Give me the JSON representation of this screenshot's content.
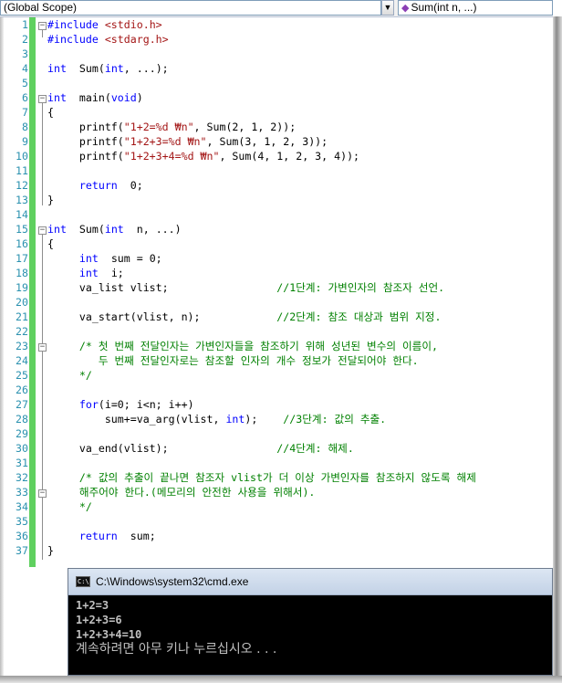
{
  "navbar": {
    "scope": "(Global Scope)",
    "member": "Sum(int n, ...)"
  },
  "editor": {
    "lines": [
      {
        "n": "1",
        "t": [
          [
            "pp",
            "#include "
          ],
          [
            "inc",
            "<stdio.h>"
          ]
        ]
      },
      {
        "n": "2",
        "t": [
          [
            "pp",
            "#include "
          ],
          [
            "inc",
            "<stdarg.h>"
          ]
        ]
      },
      {
        "n": "3",
        "t": []
      },
      {
        "n": "4",
        "t": [
          [
            "kw",
            "int"
          ],
          [
            "",
            "  Sum("
          ],
          [
            "kw",
            "int"
          ],
          [
            "",
            ", ...);"
          ]
        ]
      },
      {
        "n": "5",
        "t": []
      },
      {
        "n": "6",
        "t": [
          [
            "kw",
            "int"
          ],
          [
            "",
            "  main("
          ],
          [
            "kw",
            "void"
          ],
          [
            "",
            ")"
          ]
        ]
      },
      {
        "n": "7",
        "t": [
          [
            "",
            "{"
          ]
        ]
      },
      {
        "n": "8",
        "t": [
          [
            "",
            "     printf("
          ],
          [
            "str",
            "\"1+2=%d ₩n\""
          ],
          [
            "",
            ", Sum(2, 1, 2));"
          ]
        ]
      },
      {
        "n": "9",
        "t": [
          [
            "",
            "     printf("
          ],
          [
            "str",
            "\"1+2+3=%d ₩n\""
          ],
          [
            "",
            ", Sum(3, 1, 2, 3));"
          ]
        ]
      },
      {
        "n": "10",
        "t": [
          [
            "",
            "     printf("
          ],
          [
            "str",
            "\"1+2+3+4=%d ₩n\""
          ],
          [
            "",
            ", Sum(4, 1, 2, 3, 4));"
          ]
        ]
      },
      {
        "n": "11",
        "t": []
      },
      {
        "n": "12",
        "t": [
          [
            "",
            "     "
          ],
          [
            "kw",
            "return"
          ],
          [
            "",
            "  0;"
          ]
        ]
      },
      {
        "n": "13",
        "t": [
          [
            "",
            "}"
          ]
        ]
      },
      {
        "n": "14",
        "t": []
      },
      {
        "n": "15",
        "t": [
          [
            "kw",
            "int"
          ],
          [
            "",
            "  Sum("
          ],
          [
            "kw",
            "int"
          ],
          [
            "",
            "  n, ...)"
          ]
        ]
      },
      {
        "n": "16",
        "t": [
          [
            "",
            "{"
          ]
        ]
      },
      {
        "n": "17",
        "t": [
          [
            "",
            "     "
          ],
          [
            "kw",
            "int"
          ],
          [
            "",
            "  sum = 0;"
          ]
        ]
      },
      {
        "n": "18",
        "t": [
          [
            "",
            "     "
          ],
          [
            "kw",
            "int"
          ],
          [
            "",
            "  i;"
          ]
        ]
      },
      {
        "n": "19",
        "t": [
          [
            "",
            "     va_list vlist;                 "
          ],
          [
            "cm",
            "//1단계: 가변인자의 참조자 선언."
          ]
        ]
      },
      {
        "n": "20",
        "t": []
      },
      {
        "n": "21",
        "t": [
          [
            "",
            "     va_start(vlist, n);            "
          ],
          [
            "cm",
            "//2단계: 참조 대상과 범위 지정."
          ]
        ]
      },
      {
        "n": "22",
        "t": []
      },
      {
        "n": "23",
        "t": [
          [
            "",
            "     "
          ],
          [
            "cm",
            "/* 첫 번째 전달인자는 가변인자들을 참조하기 위해 성년된 변수의 이름이,"
          ]
        ]
      },
      {
        "n": "24",
        "t": [
          [
            "",
            "     "
          ],
          [
            "cm",
            "   두 번째 전달인자로는 참조할 인자의 개수 정보가 전달되어야 한다."
          ]
        ]
      },
      {
        "n": "25",
        "t": [
          [
            "",
            "     "
          ],
          [
            "cm",
            "*/"
          ]
        ]
      },
      {
        "n": "26",
        "t": []
      },
      {
        "n": "27",
        "t": [
          [
            "",
            "     "
          ],
          [
            "kw",
            "for"
          ],
          [
            "",
            "(i=0; i<n; i++)"
          ]
        ]
      },
      {
        "n": "28",
        "t": [
          [
            "",
            "         sum+=va_arg(vlist, "
          ],
          [
            "kw",
            "int"
          ],
          [
            "",
            ");    "
          ],
          [
            "cm",
            "//3단계: 값의 추출."
          ]
        ]
      },
      {
        "n": "29",
        "t": []
      },
      {
        "n": "30",
        "t": [
          [
            "",
            "     va_end(vlist);                 "
          ],
          [
            "cm",
            "//4단계: 해제."
          ]
        ]
      },
      {
        "n": "31",
        "t": []
      },
      {
        "n": "32",
        "t": [
          [
            "",
            "     "
          ],
          [
            "cm",
            "/* 값의 추출이 끝나면 참조자 vlist가 더 이상 가변인자를 참조하지 않도록 해제"
          ]
        ]
      },
      {
        "n": "33",
        "t": [
          [
            "",
            "     "
          ],
          [
            "cm",
            "해주어야 한다.(메모리의 안전한 사용을 위해서)."
          ]
        ]
      },
      {
        "n": "34",
        "t": [
          [
            "",
            "     "
          ],
          [
            "cm",
            "*/"
          ]
        ]
      },
      {
        "n": "35",
        "t": []
      },
      {
        "n": "36",
        "t": [
          [
            "",
            "     "
          ],
          [
            "kw",
            "return"
          ],
          [
            "",
            "  sum;"
          ]
        ]
      },
      {
        "n": "37",
        "t": [
          [
            "",
            "}"
          ]
        ]
      }
    ]
  },
  "console": {
    "icon_text": "C:\\",
    "title": "C:\\Windows\\system32\\cmd.exe",
    "output": [
      "1+2=3",
      "1+2+3=6",
      "1+2+3+4=10"
    ],
    "prompt": "계속하려면 아무 키나 누르십시오 . . ."
  },
  "colors": {
    "keyword": "#0000ff",
    "string": "#a31515",
    "comment": "#008000",
    "line_number": "#2b91af",
    "change_bar": "#5fd05f"
  }
}
